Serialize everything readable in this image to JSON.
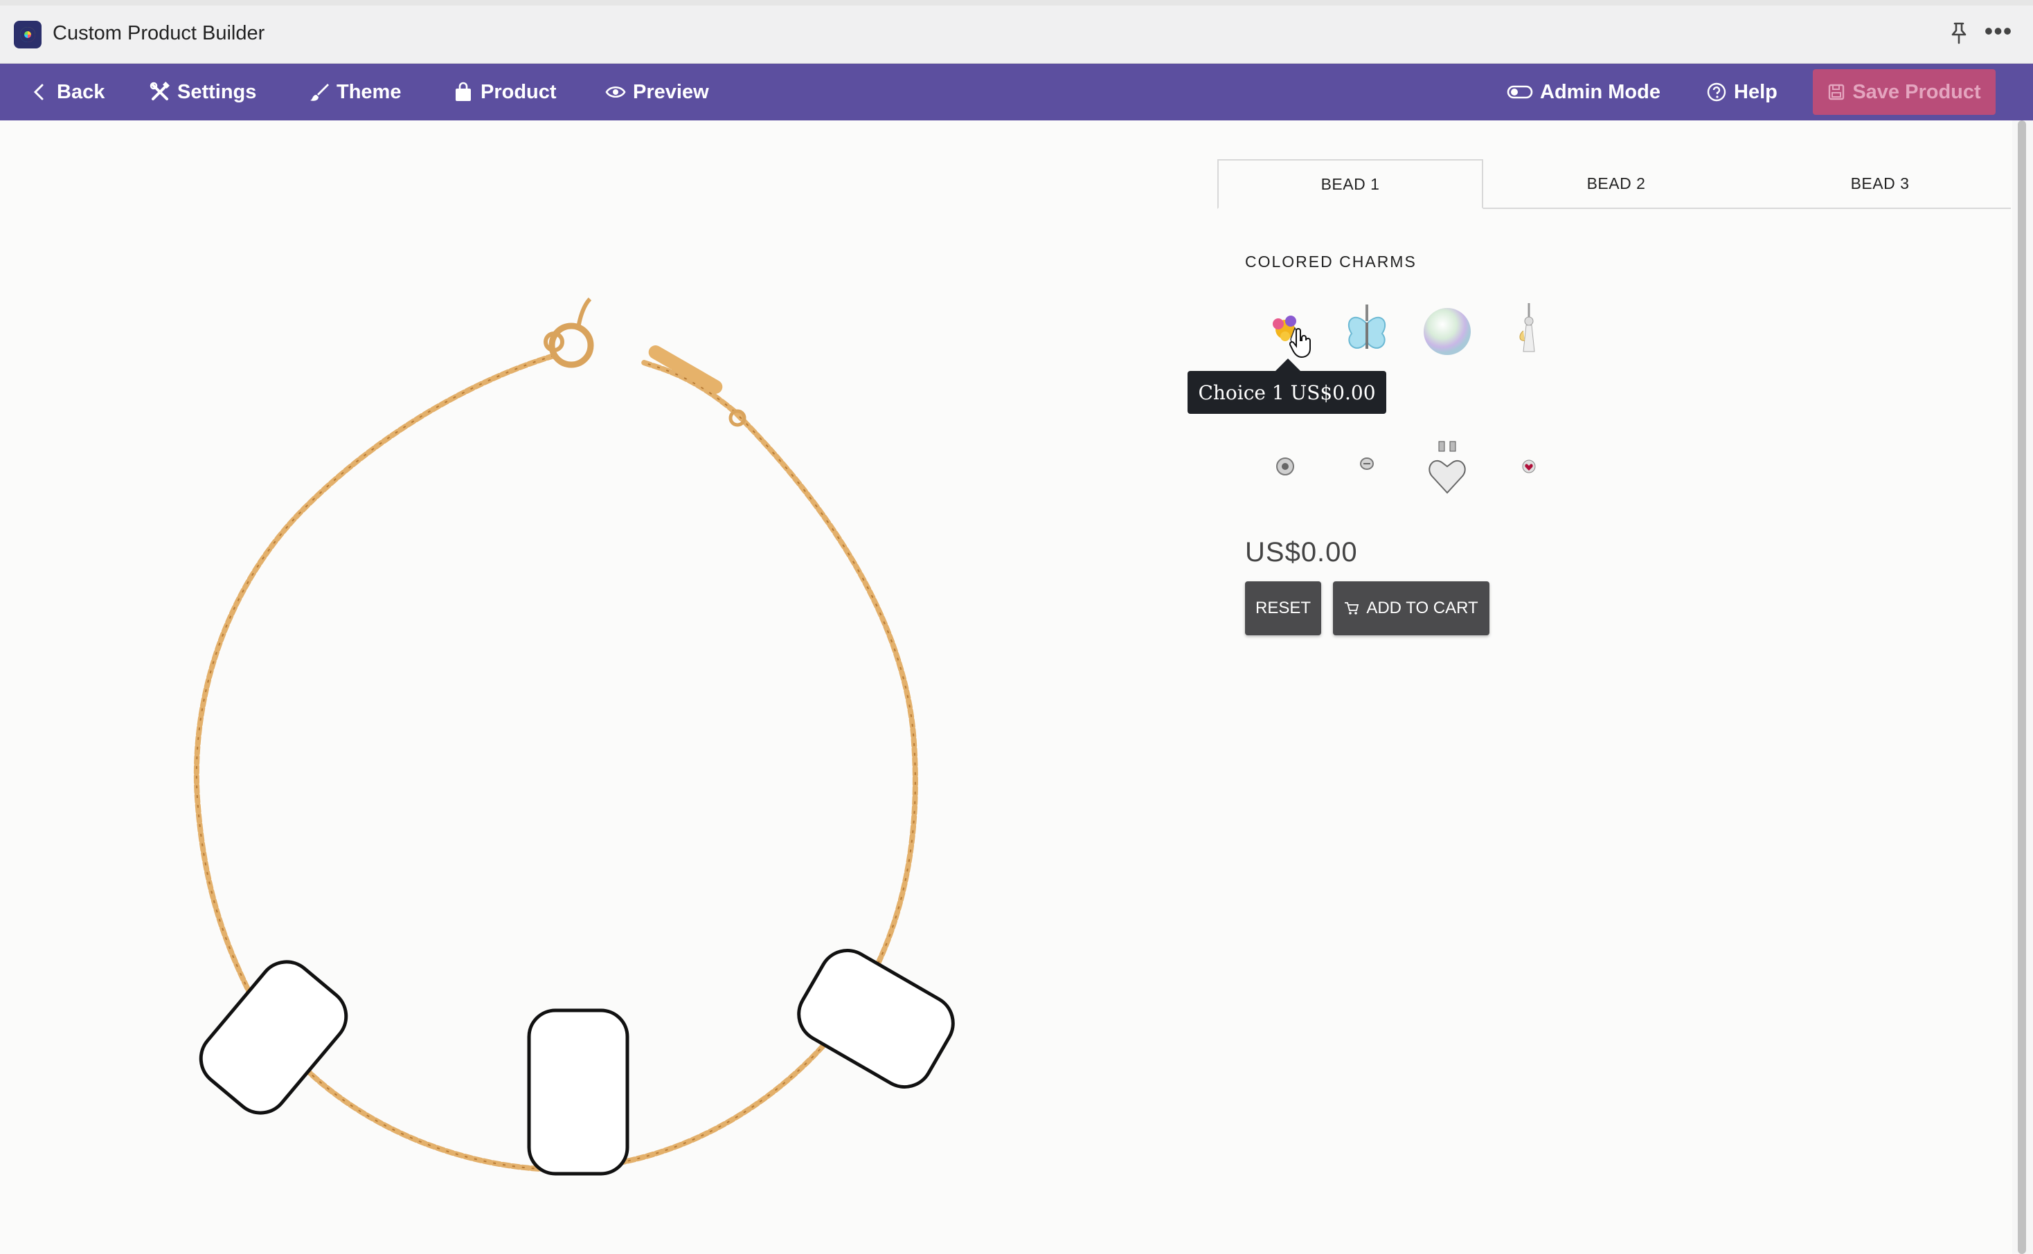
{
  "app": {
    "title": "Custom Product Builder",
    "icons": [
      "app-logo-icon",
      "pin-icon",
      "more-icon"
    ]
  },
  "toolbar": {
    "back": "Back",
    "settings": "Settings",
    "theme": "Theme",
    "product": "Product",
    "preview": "Preview",
    "admin_mode": "Admin Mode",
    "help": "Help",
    "save_product": "Save Product",
    "colors": {
      "bar": "#5c4f9f",
      "save": "#b94d79"
    }
  },
  "tabs": [
    {
      "label": "BEAD 1",
      "active": true
    },
    {
      "label": "BEAD 2",
      "active": false
    },
    {
      "label": "BEAD 3",
      "active": false
    }
  ],
  "panel": {
    "section_title": "COLORED CHARMS",
    "charms_row1": [
      "flower-charm-icon",
      "butterfly-charm-icon",
      "pearl-charm-icon",
      "angel-charm-icon"
    ],
    "charms_row2": [
      "round-bead-icon",
      "small-bead-icon",
      "heart-dangle-charm-icon",
      "ruby-heart-charm-icon"
    ],
    "tooltip": "Choice 1 US$0.00",
    "price": "US$0.00",
    "reset_label": "RESET",
    "add_to_cart_label": "ADD TO CART"
  },
  "product": {
    "slots": 3,
    "chain_color": "#d8a25b"
  }
}
